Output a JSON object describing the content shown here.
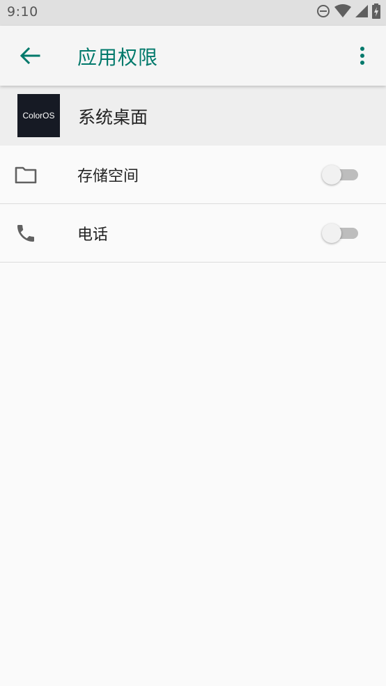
{
  "status_bar": {
    "time": "9:10",
    "icons": [
      "do-not-disturb-icon",
      "wifi-icon",
      "cell-signal-icon",
      "battery-charging-icon"
    ]
  },
  "app_bar": {
    "title": "应用权限",
    "back_icon": "arrow-back-icon",
    "more_icon": "more-vert-icon",
    "accent_color": "#00796b"
  },
  "app_header": {
    "icon_text": "ColorOS",
    "app_name": "系统桌面"
  },
  "permissions": [
    {
      "label": "存储空间",
      "icon": "folder-icon",
      "enabled": false
    },
    {
      "label": "电话",
      "icon": "phone-icon",
      "enabled": false
    }
  ]
}
